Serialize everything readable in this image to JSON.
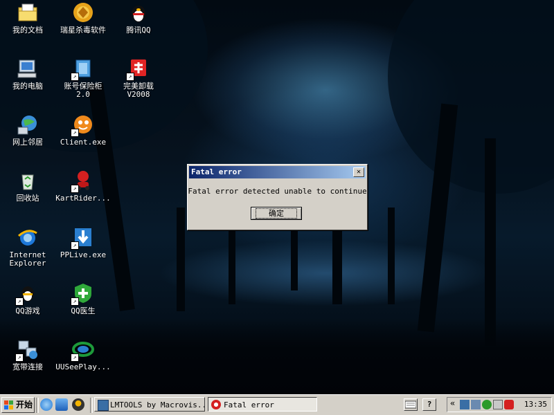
{
  "desktop_icons": [
    {
      "label": "我的文档",
      "icon": "my-documents-icon",
      "shortcut": false
    },
    {
      "label": "瑞星杀毒软件",
      "icon": "rising-antivirus-icon",
      "shortcut": false
    },
    {
      "label": "腾讯QQ",
      "icon": "qq-penguin-icon",
      "shortcut": false
    },
    {
      "label": "我的电脑",
      "icon": "my-computer-icon",
      "shortcut": false
    },
    {
      "label": "账号保险柜\n2.0",
      "icon": "account-safe-icon",
      "shortcut": true
    },
    {
      "label": "完美卸载\nV2008",
      "icon": "perfect-uninstall-icon",
      "shortcut": true
    },
    {
      "label": "网上邻居",
      "icon": "network-places-icon",
      "shortcut": false
    },
    {
      "label": "Client.exe",
      "icon": "client-exe-icon",
      "shortcut": true
    },
    {
      "label": "回收站",
      "icon": "recycle-bin-icon",
      "shortcut": false
    },
    {
      "label": "KartRider...",
      "icon": "kartrider-icon",
      "shortcut": true
    },
    {
      "label": "Internet\nExplorer",
      "icon": "internet-explorer-icon",
      "shortcut": false
    },
    {
      "label": "PPLive.exe",
      "icon": "pplive-icon",
      "shortcut": true
    },
    {
      "label": "QQ游戏",
      "icon": "qq-game-icon",
      "shortcut": true
    },
    {
      "label": "QQ医生",
      "icon": "qq-doctor-icon",
      "shortcut": true
    },
    {
      "label": "宽带连接",
      "icon": "broadband-connection-icon",
      "shortcut": true
    },
    {
      "label": "UUSeePlay...",
      "icon": "uusee-icon",
      "shortcut": true
    }
  ],
  "dialog": {
    "title": "Fatal error",
    "message": "Fatal error detected unable to continue",
    "ok_label": "确定",
    "close_symbol": "✕"
  },
  "taskbar": {
    "start_label": "开始",
    "tasks": [
      {
        "label": "LMTOOLS by Macrovis...",
        "icon": "lmtools-icon",
        "active": false
      },
      {
        "label": "Fatal error",
        "icon": "fatal-error-app-icon",
        "active": true
      }
    ],
    "quick_launch": [
      "internet-explorer-icon",
      "outlook-express-icon",
      "qq-user-icon"
    ],
    "tray": {
      "chevron": "«",
      "time": "13:35",
      "keyboard_icon": "keyboard-icon",
      "help_icon": "help-icon"
    }
  },
  "colors": {
    "titlebar_start": "#0a246a",
    "titlebar_end": "#a6caf0",
    "window_face": "#d4d0c8"
  }
}
